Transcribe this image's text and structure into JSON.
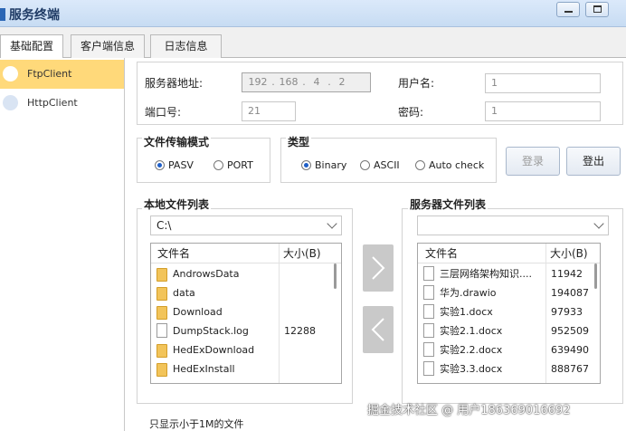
{
  "window": {
    "title": "服务终端"
  },
  "tabs": [
    {
      "label": "基础配置"
    },
    {
      "label": "客户端信息"
    },
    {
      "label": "日志信息"
    }
  ],
  "sidebar": {
    "items": [
      {
        "label": "FtpClient",
        "selected": true
      },
      {
        "label": "HttpClient",
        "selected": false
      }
    ]
  },
  "server": {
    "address_label": "服务器地址:",
    "ip": [
      "192",
      "168",
      "4",
      "2"
    ],
    "port_label": "端口号:",
    "port_value": "21",
    "user_label": "用户名:",
    "user_value": "1",
    "password_label": "密码:",
    "password_value": "1"
  },
  "transfer_mode": {
    "title": "文件传输模式",
    "options": [
      "PASV",
      "PORT"
    ],
    "selected": "PASV"
  },
  "type_group": {
    "title": "类型",
    "options": [
      "Binary",
      "ASCII",
      "Auto check"
    ],
    "selected": "Binary"
  },
  "buttons": {
    "login": "登录",
    "logout": "登出"
  },
  "local": {
    "title": "本地文件列表",
    "path": "C:\\",
    "col_name": "文件名",
    "col_size": "大小(B)",
    "rows": [
      {
        "name": "AndrowsData",
        "size": "",
        "kind": "folder"
      },
      {
        "name": "data",
        "size": "",
        "kind": "folder"
      },
      {
        "name": "Download",
        "size": "",
        "kind": "folder"
      },
      {
        "name": "DumpStack.log",
        "size": "12288",
        "kind": "file"
      },
      {
        "name": "HedExDownload",
        "size": "",
        "kind": "folder"
      },
      {
        "name": "HedExInstall",
        "size": "",
        "kind": "folder"
      }
    ]
  },
  "remote": {
    "title": "服务器文件列表",
    "path": "",
    "col_name": "文件名",
    "col_size": "大小(B)",
    "rows": [
      {
        "name": "三层网络架构知识....",
        "size": "11942",
        "kind": "file"
      },
      {
        "name": "华为.drawio",
        "size": "194087",
        "kind": "file"
      },
      {
        "name": "实验1.docx",
        "size": "97933",
        "kind": "file"
      },
      {
        "name": "实验2.1.docx",
        "size": "952509",
        "kind": "file"
      },
      {
        "name": "实验2.2.docx",
        "size": "639490",
        "kind": "file"
      },
      {
        "name": "实验3.3.docx",
        "size": "888767",
        "kind": "file"
      }
    ]
  },
  "filter_note": "只显示小于1M的文件",
  "watermark": "掘金技术社区 @ 用户186369016692",
  "icons": {
    "upload": "chevron-right-icon",
    "download": "chevron-left-icon"
  }
}
